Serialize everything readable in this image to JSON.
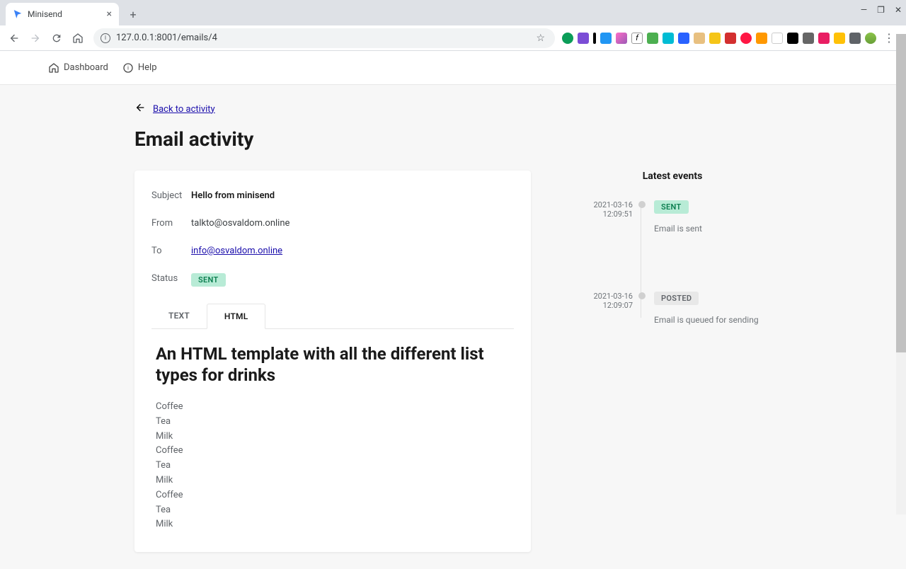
{
  "browser": {
    "tab_title": "Minisend",
    "url": "127.0.0.1:8001/emails/4"
  },
  "nav": {
    "dashboard": "Dashboard",
    "help": "Help"
  },
  "back_link": "Back to activity",
  "page_title": "Email activity",
  "details": {
    "subject_label": "Subject",
    "subject_value": "Hello from minisend",
    "from_label": "From",
    "from_value": "talkto@osvaldom.online",
    "to_label": "To",
    "to_value": "info@osvaldom.online",
    "status_label": "Status",
    "status_badge": "SENT"
  },
  "tabs": {
    "text": "TEXT",
    "html": "HTML"
  },
  "email_content": {
    "title": "An HTML template with all the different list types for drinks",
    "items": [
      "Coffee",
      "Tea",
      "Milk",
      "Coffee",
      "Tea",
      "Milk",
      "Coffee",
      "Tea",
      "Milk"
    ]
  },
  "timeline": {
    "title": "Latest events",
    "events": [
      {
        "time": "2021-03-16 12:09:51",
        "badge": "SENT",
        "badge_type": "sent",
        "desc": "Email is sent"
      },
      {
        "time": "2021-03-16 12:09:07",
        "badge": "POSTED",
        "badge_type": "posted",
        "desc": "Email is queued for sending"
      }
    ]
  }
}
